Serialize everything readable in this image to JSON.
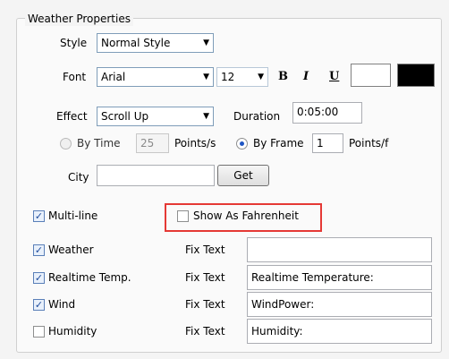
{
  "group_title": "Weather Properties",
  "style": {
    "label": "Style",
    "value": "Normal Style"
  },
  "font": {
    "label": "Font",
    "family": "Arial",
    "size": "12",
    "bold_label": "B",
    "italic_label": "I",
    "underline_label": "U",
    "fore_color": "#ffffff",
    "back_color": "#000000"
  },
  "effect": {
    "label": "Effect",
    "value": "Scroll Up",
    "duration_label": "Duration",
    "duration_value": "0:05:00"
  },
  "timing": {
    "by_time_label": "By Time",
    "by_time_value": "25",
    "by_time_unit": "Points/s",
    "by_time_selected": false,
    "by_frame_label": "By Frame",
    "by_frame_value": "1",
    "by_frame_unit": "Points/f",
    "by_frame_selected": true
  },
  "city": {
    "label": "City",
    "value": "",
    "get_label": "Get"
  },
  "multiline": {
    "label": "Multi-line",
    "checked": true
  },
  "fahrenheit": {
    "label": "Show As Fahrenheit",
    "checked": false
  },
  "fix_text_label": "Fix Text",
  "items": [
    {
      "label": "Weather",
      "checked": true,
      "fix_text": ""
    },
    {
      "label": "Realtime Temp.",
      "checked": true,
      "fix_text": "Realtime Temperature:"
    },
    {
      "label": "Wind",
      "checked": true,
      "fix_text": "WindPower:"
    },
    {
      "label": "Humidity",
      "checked": false,
      "fix_text": "Humidity:"
    }
  ]
}
